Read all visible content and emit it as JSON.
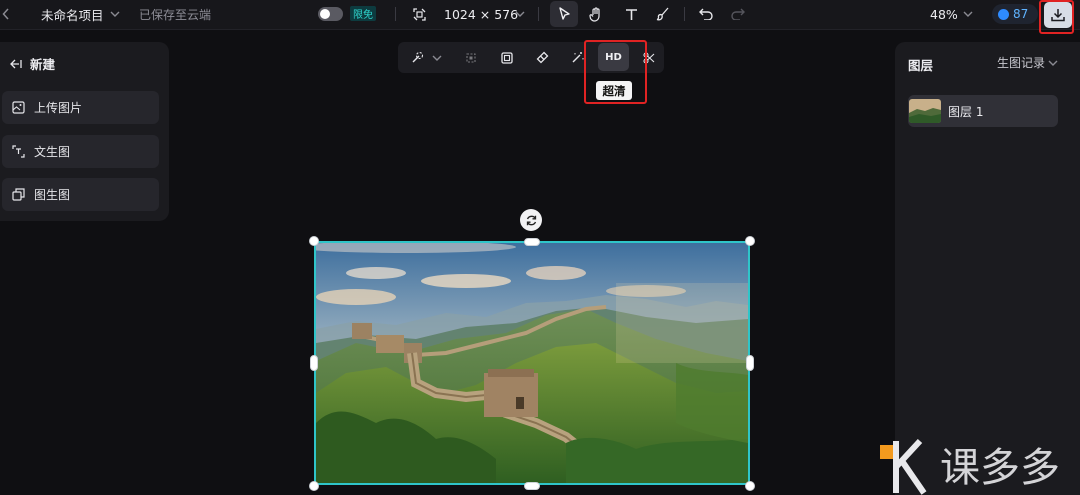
{
  "header": {
    "project_title": "未命名项目",
    "save_status": "已保存至云端",
    "free_badge": "限免",
    "canvas_size": "1024 × 576",
    "zoom": "48%",
    "credits": "87"
  },
  "tools": {
    "select": "cursor-icon",
    "hand": "hand-icon",
    "text": "text-icon",
    "brush": "brush-icon",
    "undo": "undo-icon",
    "redo": "redo-icon",
    "download": "download-icon"
  },
  "left_panel": {
    "header": "新建",
    "buttons": [
      {
        "label": "上传图片",
        "icon": "upload-image-icon"
      },
      {
        "label": "文生图",
        "icon": "text-to-image-icon"
      },
      {
        "label": "图生图",
        "icon": "image-to-image-icon"
      }
    ]
  },
  "float_toolbar": {
    "hd_label": "HD",
    "tooltip": "超清"
  },
  "right_panel": {
    "title": "图层",
    "history": "生图记录",
    "layers": [
      {
        "label": "图层 1"
      }
    ]
  },
  "colors": {
    "accent": "#2fc5c9",
    "highlight": "#e02323",
    "credits": "#2e8bff"
  }
}
